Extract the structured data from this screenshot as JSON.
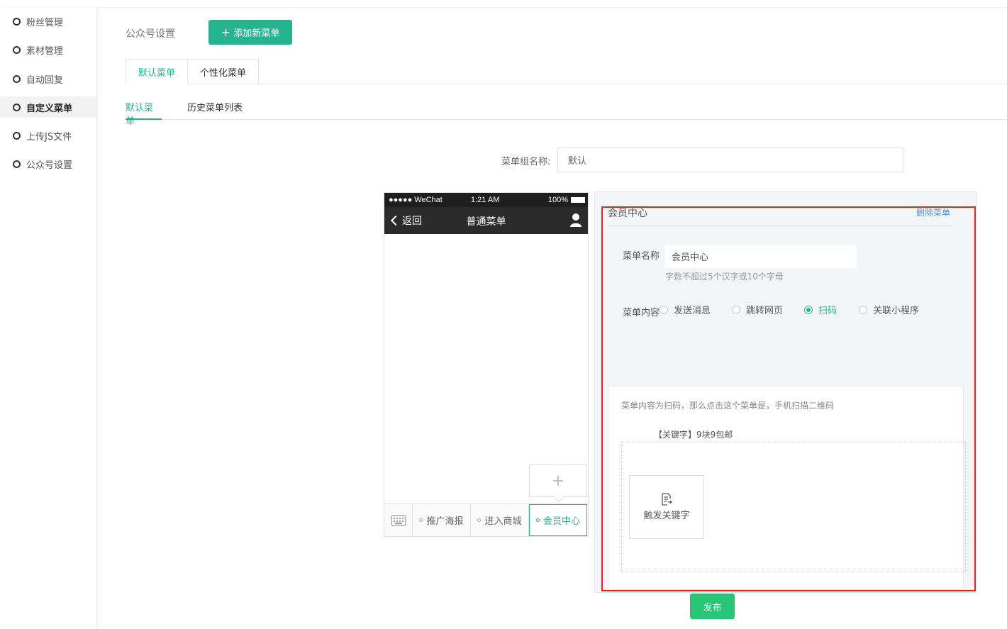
{
  "sidebar": {
    "items": [
      {
        "label": "粉丝管理"
      },
      {
        "label": "素材管理"
      },
      {
        "label": "自动回复"
      },
      {
        "label": "自定义菜单"
      },
      {
        "label": "上传JS文件"
      },
      {
        "label": "公众号设置"
      }
    ],
    "active_index": 3
  },
  "header": {
    "title": "公众号设置",
    "add_button": "添加新菜单"
  },
  "tabs_primary": [
    {
      "label": "默认菜单"
    },
    {
      "label": "个性化菜单"
    }
  ],
  "tabs_secondary": [
    {
      "label": "默认菜单"
    },
    {
      "label": "历史菜单列表"
    }
  ],
  "group": {
    "label": "菜单组名称:",
    "value": "默认"
  },
  "phone": {
    "status": {
      "signal": "●●●●● WeChat",
      "time": "1:21 AM",
      "battery": "100%"
    },
    "nav": {
      "back": "返回",
      "title": "普通菜单"
    },
    "add_sub": "+",
    "menu": [
      {
        "label": "推广海报"
      },
      {
        "label": "进入商城"
      },
      {
        "label": "会员中心"
      }
    ]
  },
  "editor": {
    "title": "会员中心",
    "delete_link": "删除菜单",
    "name_label": "菜单名称",
    "name_value": "会员中心",
    "name_hint": "字数不超过5个汉字或10个字母",
    "content_label": "菜单内容",
    "options": [
      {
        "label": "发送消息"
      },
      {
        "label": "跳转网页"
      },
      {
        "label": "扫码"
      },
      {
        "label": "关联小程序"
      }
    ],
    "selected_option": "扫码",
    "scan_description": "菜单内容为扫码，那么点击这个菜单是，手机扫描二维码",
    "keyword": "【关键字】9块9包邮",
    "trigger_label": "触发关键字"
  },
  "publish_button": "发布",
  "colors": {
    "accent": "#26b48f",
    "publish": "#26c676",
    "highlight": "#e3231f",
    "link": "#5b8fd6"
  }
}
